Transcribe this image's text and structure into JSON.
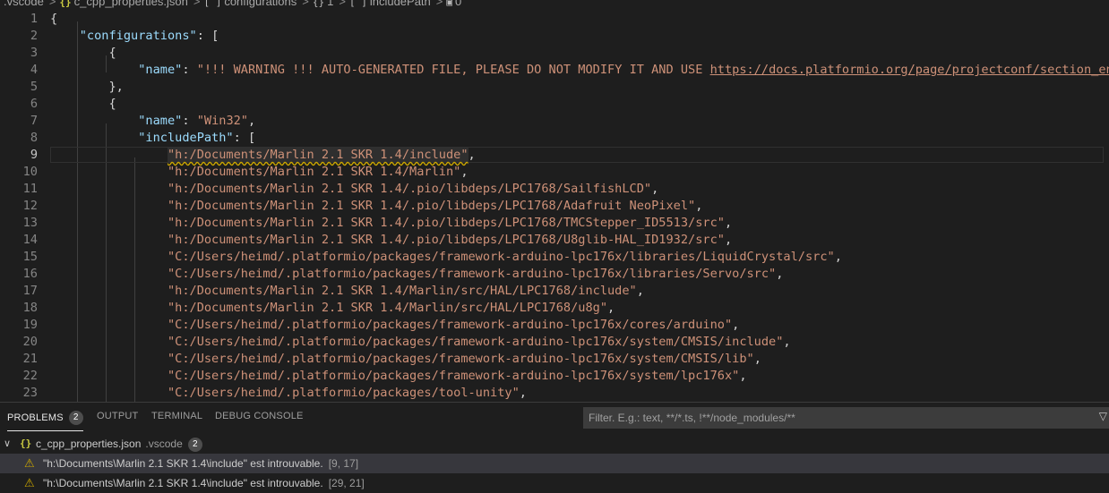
{
  "breadcrumb": {
    "items": [
      ".vscode",
      "c_cpp_properties.json",
      "configurations",
      "1",
      "includePath",
      "0"
    ],
    "separator": ">"
  },
  "editor": {
    "lines": [
      {
        "n": "1",
        "tokens": [
          [
            "p",
            "{"
          ]
        ]
      },
      {
        "n": "2",
        "tokens": [
          [
            "p",
            "    "
          ],
          [
            "k",
            "\"configurations\""
          ],
          [
            "p",
            ": ["
          ]
        ]
      },
      {
        "n": "3",
        "tokens": [
          [
            "p",
            "        {"
          ]
        ]
      },
      {
        "n": "4",
        "tokens": [
          [
            "p",
            "            "
          ],
          [
            "k",
            "\"name\""
          ],
          [
            "p",
            ": "
          ],
          [
            "s",
            "\"!!! WARNING !!! AUTO-GENERATED FILE, PLEASE DO NOT MODIFY IT AND USE "
          ],
          [
            "su",
            "https://docs.platformio.org/page/projectconf/section_env_build."
          ]
        ]
      },
      {
        "n": "5",
        "tokens": [
          [
            "p",
            "        },"
          ]
        ]
      },
      {
        "n": "6",
        "tokens": [
          [
            "p",
            "        {"
          ]
        ]
      },
      {
        "n": "7",
        "tokens": [
          [
            "p",
            "            "
          ],
          [
            "k",
            "\"name\""
          ],
          [
            "p",
            ": "
          ],
          [
            "s",
            "\"Win32\""
          ],
          [
            "p",
            ","
          ]
        ]
      },
      {
        "n": "8",
        "tokens": [
          [
            "p",
            "            "
          ],
          [
            "k",
            "\"includePath\""
          ],
          [
            "p",
            ": ["
          ]
        ]
      },
      {
        "n": "9",
        "current": true,
        "tokens": [
          [
            "p",
            "                "
          ],
          [
            "sq",
            "\"h:/Documents/Marlin 2.1 SKR 1.4/include\""
          ],
          [
            "p",
            ","
          ]
        ]
      },
      {
        "n": "10",
        "tokens": [
          [
            "p",
            "                "
          ],
          [
            "s",
            "\"h:/Documents/Marlin 2.1 SKR 1.4/Marlin\""
          ],
          [
            "p",
            ","
          ]
        ]
      },
      {
        "n": "11",
        "tokens": [
          [
            "p",
            "                "
          ],
          [
            "s",
            "\"h:/Documents/Marlin 2.1 SKR 1.4/.pio/libdeps/LPC1768/SailfishLCD\""
          ],
          [
            "p",
            ","
          ]
        ]
      },
      {
        "n": "12",
        "tokens": [
          [
            "p",
            "                "
          ],
          [
            "s",
            "\"h:/Documents/Marlin 2.1 SKR 1.4/.pio/libdeps/LPC1768/Adafruit NeoPixel\""
          ],
          [
            "p",
            ","
          ]
        ]
      },
      {
        "n": "13",
        "tokens": [
          [
            "p",
            "                "
          ],
          [
            "s",
            "\"h:/Documents/Marlin 2.1 SKR 1.4/.pio/libdeps/LPC1768/TMCStepper_ID5513/src\""
          ],
          [
            "p",
            ","
          ]
        ]
      },
      {
        "n": "14",
        "tokens": [
          [
            "p",
            "                "
          ],
          [
            "s",
            "\"h:/Documents/Marlin 2.1 SKR 1.4/.pio/libdeps/LPC1768/U8glib-HAL_ID1932/src\""
          ],
          [
            "p",
            ","
          ]
        ]
      },
      {
        "n": "15",
        "tokens": [
          [
            "p",
            "                "
          ],
          [
            "s",
            "\"C:/Users/heimd/.platformio/packages/framework-arduino-lpc176x/libraries/LiquidCrystal/src\""
          ],
          [
            "p",
            ","
          ]
        ]
      },
      {
        "n": "16",
        "tokens": [
          [
            "p",
            "                "
          ],
          [
            "s",
            "\"C:/Users/heimd/.platformio/packages/framework-arduino-lpc176x/libraries/Servo/src\""
          ],
          [
            "p",
            ","
          ]
        ]
      },
      {
        "n": "17",
        "tokens": [
          [
            "p",
            "                "
          ],
          [
            "s",
            "\"h:/Documents/Marlin 2.1 SKR 1.4/Marlin/src/HAL/LPC1768/include\""
          ],
          [
            "p",
            ","
          ]
        ]
      },
      {
        "n": "18",
        "tokens": [
          [
            "p",
            "                "
          ],
          [
            "s",
            "\"h:/Documents/Marlin 2.1 SKR 1.4/Marlin/src/HAL/LPC1768/u8g\""
          ],
          [
            "p",
            ","
          ]
        ]
      },
      {
        "n": "19",
        "tokens": [
          [
            "p",
            "                "
          ],
          [
            "s",
            "\"C:/Users/heimd/.platformio/packages/framework-arduino-lpc176x/cores/arduino\""
          ],
          [
            "p",
            ","
          ]
        ]
      },
      {
        "n": "20",
        "tokens": [
          [
            "p",
            "                "
          ],
          [
            "s",
            "\"C:/Users/heimd/.platformio/packages/framework-arduino-lpc176x/system/CMSIS/include\""
          ],
          [
            "p",
            ","
          ]
        ]
      },
      {
        "n": "21",
        "tokens": [
          [
            "p",
            "                "
          ],
          [
            "s",
            "\"C:/Users/heimd/.platformio/packages/framework-arduino-lpc176x/system/CMSIS/lib\""
          ],
          [
            "p",
            ","
          ]
        ]
      },
      {
        "n": "22",
        "tokens": [
          [
            "p",
            "                "
          ],
          [
            "s",
            "\"C:/Users/heimd/.platformio/packages/framework-arduino-lpc176x/system/lpc176x\""
          ],
          [
            "p",
            ","
          ]
        ]
      },
      {
        "n": "23",
        "tokens": [
          [
            "p",
            "                "
          ],
          [
            "s",
            "\"C:/Users/heimd/.platformio/packages/tool-unity\""
          ],
          [
            "p",
            ","
          ]
        ]
      }
    ]
  },
  "panel": {
    "tabs": [
      {
        "label": "PROBLEMS",
        "badge": "2",
        "active": true
      },
      {
        "label": "OUTPUT"
      },
      {
        "label": "TERMINAL"
      },
      {
        "label": "DEBUG CONSOLE"
      }
    ],
    "filter_placeholder": "Filter. E.g.: text, **/*.ts, !**/node_modules/**",
    "file": {
      "name": "c_cpp_properties.json",
      "dir": ".vscode",
      "count": "2"
    },
    "problems": [
      {
        "message": "\"h:\\Documents\\Marlin 2.1 SKR 1.4\\include\" est introuvable.",
        "position": "[9, 17]",
        "selected": true
      },
      {
        "message": "\"h:\\Documents\\Marlin 2.1 SKR 1.4\\include\" est introuvable.",
        "position": "[29, 21]"
      }
    ]
  },
  "colors": {
    "background": "#1e1e1e",
    "key": "#9cdcfe",
    "string": "#ce9178",
    "warning": "#cca700",
    "json_icon": "#cbcb41"
  },
  "icons": [
    "json-file-icon",
    "array-icon",
    "object-icon",
    "number-icon",
    "warning-icon",
    "chevron-down-icon",
    "filter-icon"
  ]
}
